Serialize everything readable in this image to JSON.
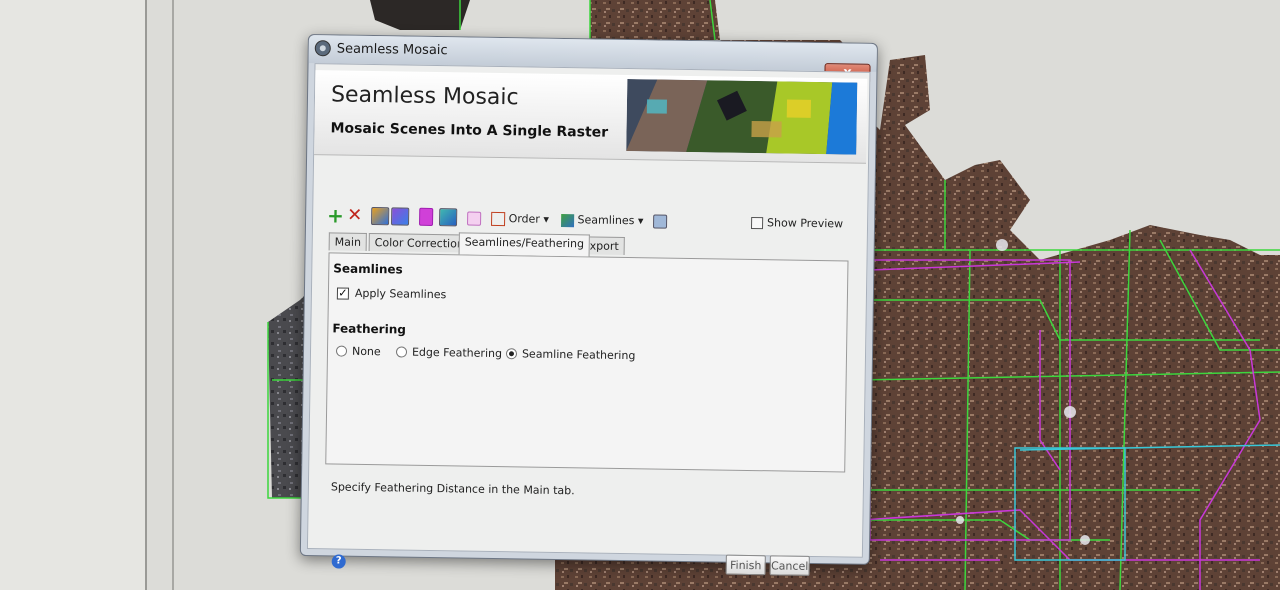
{
  "dialog": {
    "title": "Seamless Mosaic",
    "close_label": "x",
    "banner": {
      "title": "Seamless Mosaic",
      "subtitle": "Mosaic Scenes Into A Single Raster"
    },
    "toolbar": {
      "add_icon": "add-plus-icon",
      "remove_icon": "remove-x-icon",
      "order_label": "Order",
      "seamlines_label": "Seamlines",
      "show_preview_label": "Show Preview",
      "show_preview_checked": false
    },
    "tabs": [
      {
        "label": "Main",
        "active": false
      },
      {
        "label": "Color Correction",
        "active": false
      },
      {
        "label": "Seamlines/Feathering",
        "active": true
      },
      {
        "label": "Export",
        "active": false
      }
    ],
    "seamlines": {
      "heading": "Seamlines",
      "apply_label": "Apply Seamlines",
      "apply_checked": true
    },
    "feathering": {
      "heading": "Feathering",
      "options": [
        {
          "label": "None",
          "selected": false
        },
        {
          "label": "Edge Feathering",
          "selected": false
        },
        {
          "label": "Seamline Feathering",
          "selected": true
        }
      ]
    },
    "status_text": "Specify Feathering Distance in the Main tab.",
    "finish_label": "Finish",
    "cancel_label": "Cancel"
  },
  "colors": {
    "seamline_green": "#3dd63d",
    "footprint_magenta": "#c838d8",
    "footprint_cyan": "#38c8d8",
    "imagery_brown": "#6e4a3c"
  }
}
